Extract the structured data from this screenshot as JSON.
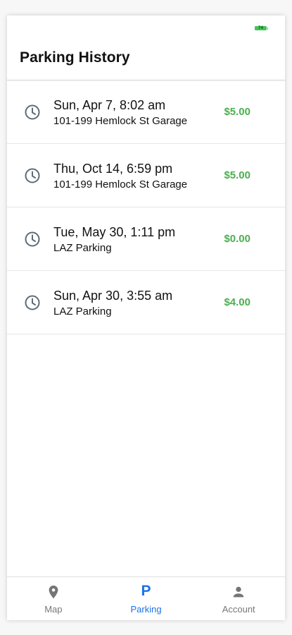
{
  "status": {
    "battery_label": "74"
  },
  "header": {
    "title": "Parking History"
  },
  "history": [
    {
      "when": "Sun, Apr 7, 8:02 am",
      "where": "101-199 Hemlock St Garage",
      "amount": "$5.00"
    },
    {
      "when": "Thu, Oct 14, 6:59 pm",
      "where": "101-199 Hemlock St Garage",
      "amount": "$5.00"
    },
    {
      "when": "Tue, May 30, 1:11 pm",
      "where": "LAZ Parking",
      "amount": "$0.00"
    },
    {
      "when": "Sun, Apr 30, 3:55 am",
      "where": "LAZ Parking",
      "amount": "$4.00"
    }
  ],
  "nav": {
    "map_label": "Map",
    "parking_label": "Parking",
    "parking_glyph": "P",
    "account_label": "Account"
  },
  "colors": {
    "accent": "#1a73e8",
    "amount": "#4caf50",
    "icon": "#5f6b75",
    "battery": "#46c35b"
  }
}
